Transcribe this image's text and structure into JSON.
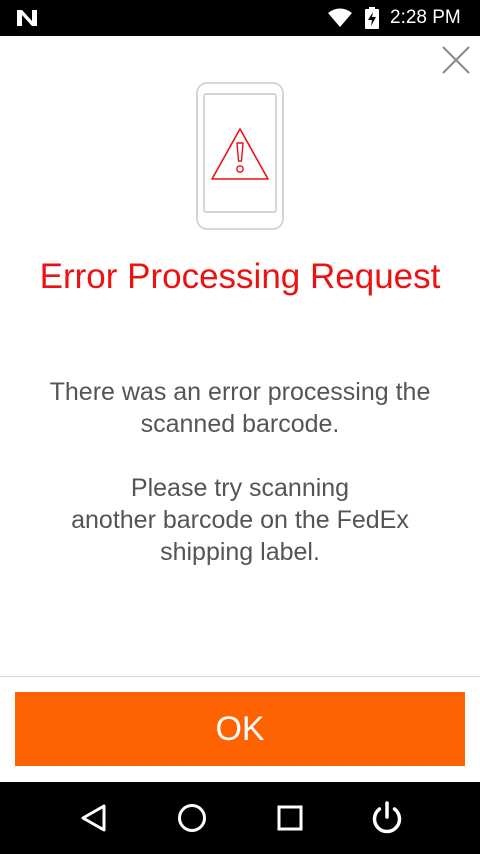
{
  "status_bar": {
    "time": "2:28 PM",
    "icons": [
      "android-n-icon",
      "wifi-icon",
      "battery-charging-icon"
    ]
  },
  "dialog": {
    "close_icon": "close-icon",
    "illustration_icon": "phone-warning-icon",
    "title": "Error Processing Request",
    "message_line_1": "There was an error processing the",
    "message_line_2": "scanned barcode.",
    "message_line_3": "Please try scanning",
    "message_line_4": "another barcode on the FedEx",
    "message_line_5": "shipping label.",
    "ok_label": "OK"
  },
  "nav_bar": {
    "icons": [
      "back-icon",
      "home-icon",
      "recents-icon",
      "power-icon"
    ]
  },
  "colors": {
    "title_red": "#ee1111",
    "accent_orange": "#ff6200",
    "message_gray": "#555555",
    "bar_black": "#000000"
  }
}
